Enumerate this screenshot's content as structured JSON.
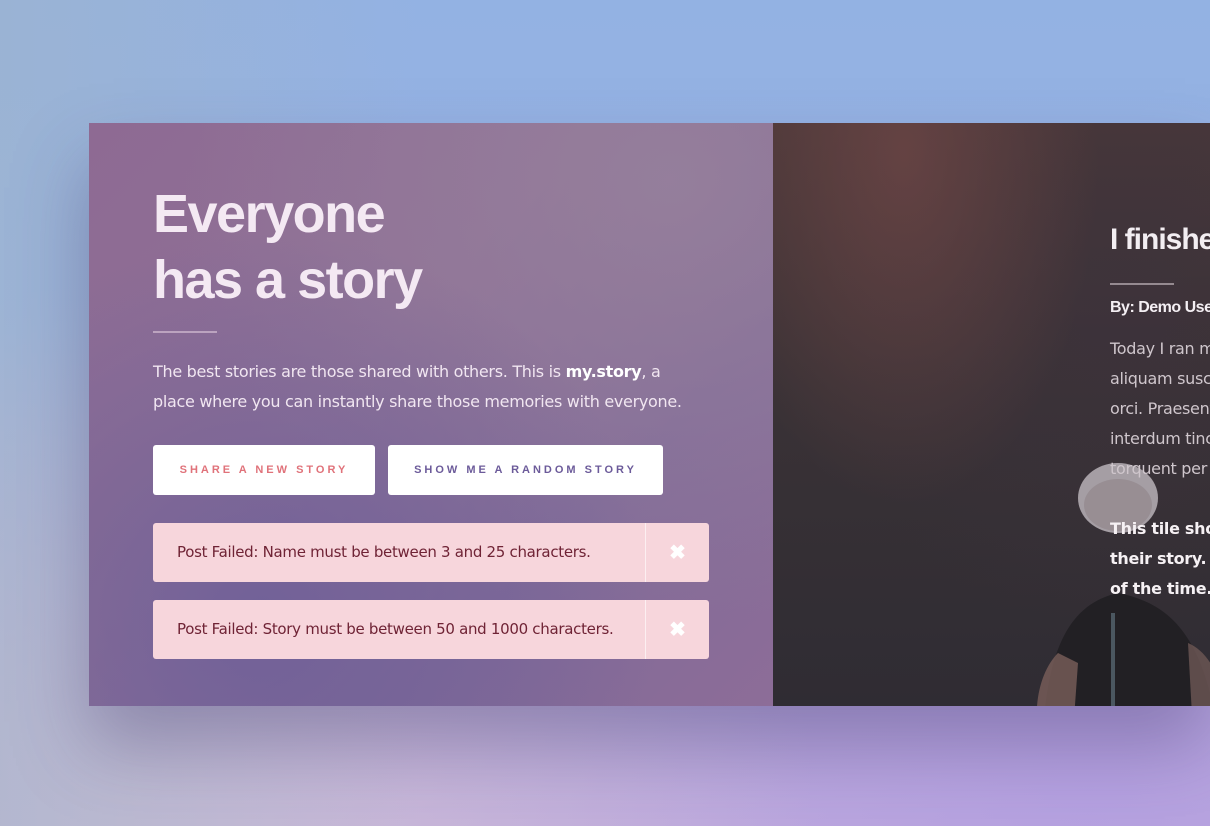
{
  "hero": {
    "title_line1": "Everyone",
    "title_line2": "has a story",
    "desc_before": "The best stories are those shared with others. This is ",
    "desc_brand": "my.story",
    "desc_after": ", a place where you can instantly share those memories with everyone."
  },
  "buttons": {
    "share_label": "SHARE A NEW STORY",
    "random_label": "SHOW ME A RANDOM STORY"
  },
  "alerts": [
    {
      "message": "Post Failed: Name must be between 3 and 25 characters.",
      "close": "✖"
    },
    {
      "message": "Post Failed: Story must be between 50 and 1000 characters.",
      "close": "✖"
    }
  ],
  "story": {
    "title": "I finishe",
    "author": "By: Demo Use",
    "body_lines": [
      "Today I ran m",
      "aliquam susci",
      "orci. Praesent",
      "interdum tinc",
      "torquent per c"
    ],
    "note_lines": [
      "This tile show",
      "their story. A",
      "of the time."
    ]
  },
  "colors": {
    "share_button_text": "#e0727a",
    "random_button_text": "#6c5b9a",
    "alert_background": "#f7d6dc",
    "alert_text": "#6f2335"
  }
}
